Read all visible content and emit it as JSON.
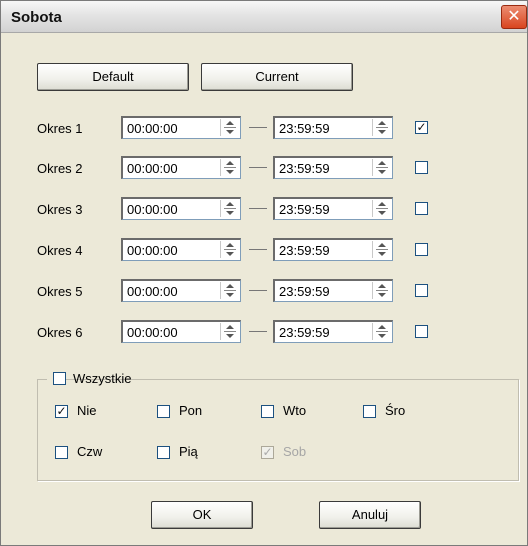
{
  "window": {
    "title": "Sobota",
    "close_glyph": "✕"
  },
  "buttons": {
    "default": "Default",
    "current": "Current",
    "ok": "OK",
    "cancel": "Anuluj"
  },
  "periods": [
    {
      "label": "Okres 1",
      "start": "00:00:00",
      "end": "23:59:59",
      "checked": true
    },
    {
      "label": "Okres 2",
      "start": "00:00:00",
      "end": "23:59:59",
      "checked": false
    },
    {
      "label": "Okres 3",
      "start": "00:00:00",
      "end": "23:59:59",
      "checked": false
    },
    {
      "label": "Okres 4",
      "start": "00:00:00",
      "end": "23:59:59",
      "checked": false
    },
    {
      "label": "Okres 5",
      "start": "00:00:00",
      "end": "23:59:59",
      "checked": false
    },
    {
      "label": "Okres 6",
      "start": "00:00:00",
      "end": "23:59:59",
      "checked": false
    }
  ],
  "days_group": {
    "all_label": "Wszystkie",
    "all_checked": false,
    "days": [
      {
        "label": "Nie",
        "checked": true,
        "disabled": false
      },
      {
        "label": "Pon",
        "checked": false,
        "disabled": false
      },
      {
        "label": "Wto",
        "checked": false,
        "disabled": false
      },
      {
        "label": "Śro",
        "checked": false,
        "disabled": false
      },
      {
        "label": "Czw",
        "checked": false,
        "disabled": false
      },
      {
        "label": "Pią",
        "checked": false,
        "disabled": false
      },
      {
        "label": "Sob",
        "checked": true,
        "disabled": true
      }
    ]
  }
}
